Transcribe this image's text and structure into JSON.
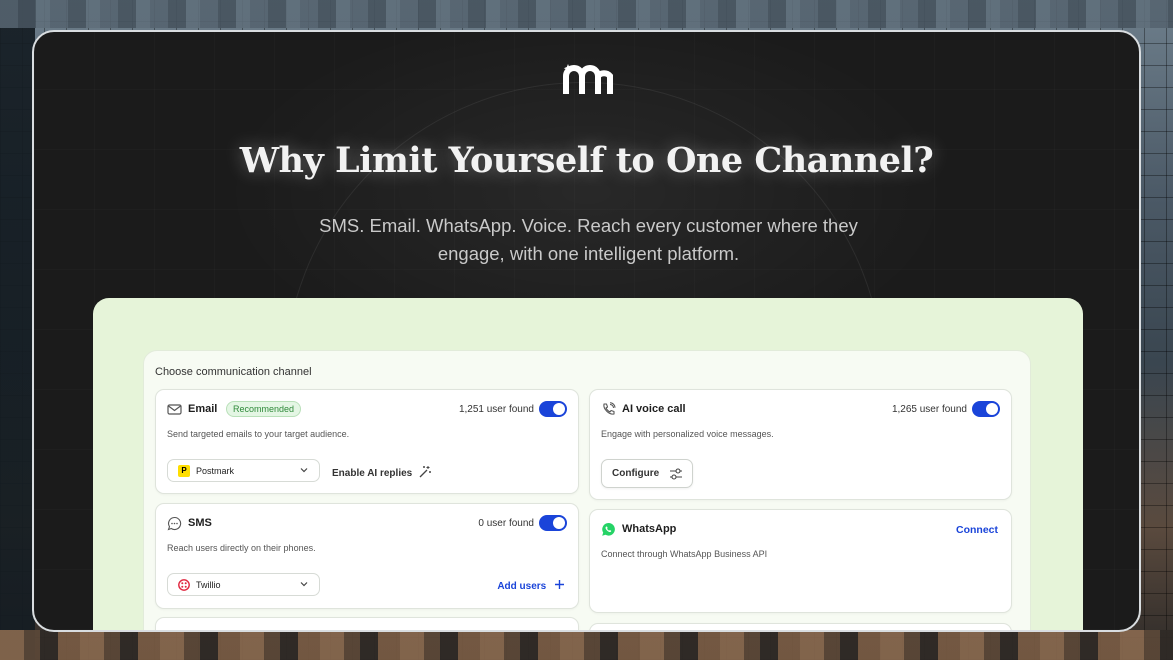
{
  "hero": {
    "headline": "Why Limit Yourself to One Channel?",
    "subtitle": "SMS. Email. WhatsApp. Voice. Reach every customer where they engage, with one intelligent platform."
  },
  "channel_picker": {
    "title": "Choose communication channel",
    "email": {
      "name": "Email",
      "badge": "Recommended",
      "count": "1,251 user found",
      "enabled": true,
      "description": "Send targeted emails to your target audience.",
      "provider": "Postmark",
      "action": "Enable AI replies"
    },
    "ai_voice": {
      "name": "AI voice call",
      "count": "1,265 user found",
      "enabled": true,
      "description": "Engage with personalized voice messages.",
      "action": "Configure"
    },
    "sms": {
      "name": "SMS",
      "count": "0 user found",
      "enabled": true,
      "description": "Reach users directly on their phones.",
      "provider": "Twillio",
      "action": "Add users"
    },
    "whatsapp": {
      "name": "WhatsApp",
      "description": "Connect through WhatsApp Business API",
      "action": "Connect"
    }
  },
  "colors": {
    "accent": "#1a44d9",
    "panel": "#e6f4d9",
    "whatsapp": "#25d366",
    "badge_text": "#2f8a3a"
  }
}
